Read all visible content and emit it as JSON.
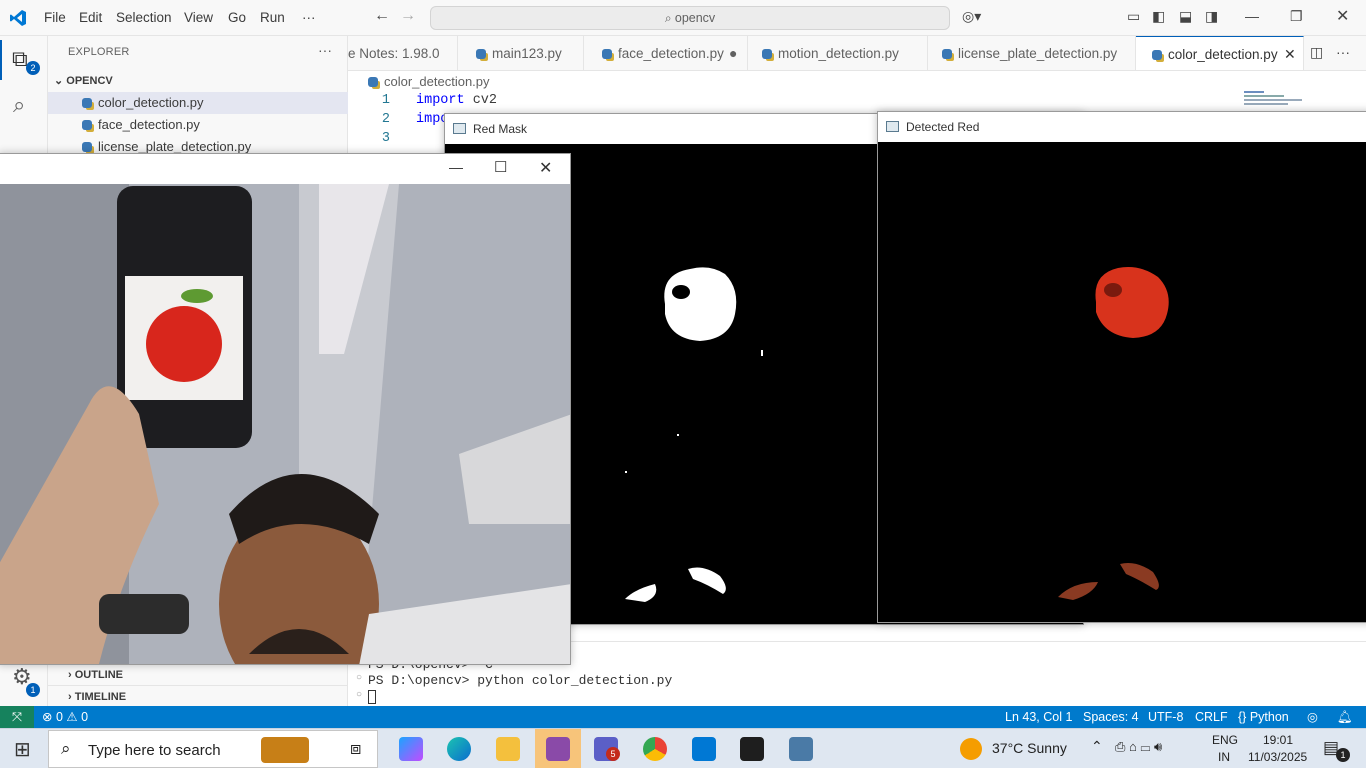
{
  "menu": [
    "File",
    "Edit",
    "Selection",
    "View",
    "Go",
    "Run",
    "···"
  ],
  "search": "opencv",
  "explorer": {
    "title": "EXPLORER",
    "folder": "OPENCV",
    "files": [
      "color_detection.py",
      "face_detection.py",
      "license_plate_detection.py"
    ],
    "outline": "OUTLINE",
    "timeline": "TIMELINE",
    "badge": "2",
    "settings_badge": "1"
  },
  "tabs": [
    {
      "label": "e Notes: 1.98.0"
    },
    {
      "label": "main123.py"
    },
    {
      "label": "face_detection.py",
      "modified": true
    },
    {
      "label": "motion_detection.py"
    },
    {
      "label": "license_plate_detection.py"
    },
    {
      "label": "color_detection.py",
      "active": true
    }
  ],
  "breadcrumb": "color_detection.py",
  "code": [
    {
      "n": "1",
      "kw": "import",
      "rest": " cv2"
    },
    {
      "n": "2",
      "kw": "impo",
      "rest": ""
    },
    {
      "n": "3",
      "kw": "",
      "rest": ""
    }
  ],
  "terminal": [
    "PS D:\\opencv> ^C",
    "PS D:\\opencv> python color_detection.py"
  ],
  "windows": {
    "red_mask": "Red Mask",
    "detected_red": "Detected Red"
  },
  "status": {
    "errors": "0",
    "warnings": "0",
    "position": "Ln 43, Col 1",
    "spaces": "Spaces: 4",
    "encoding": "UTF-8",
    "eol": "CRLF",
    "language": "Python"
  },
  "taskbar": {
    "search_placeholder": "Type here to search",
    "weather": "37°C  Sunny",
    "lang1": "ENG",
    "lang2": "IN",
    "time": "19:01",
    "date": "11/03/2025",
    "notif": "1",
    "teams_badge": "5"
  },
  "colors": {
    "accent": "#007acc",
    "remote": "#16825d",
    "apple": "#d8261c"
  }
}
